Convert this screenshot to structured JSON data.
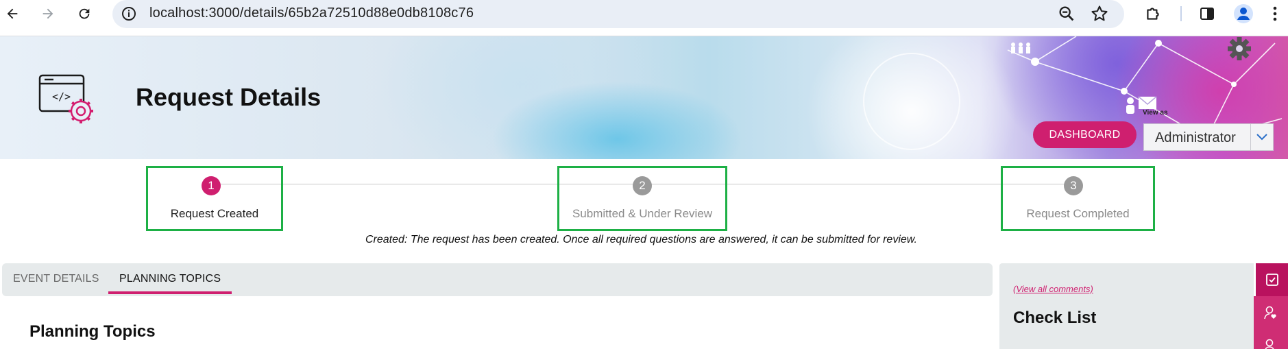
{
  "browser": {
    "url": "localhost:3000/details/65b2a72510d88e0db8108c76",
    "icons": [
      "back-arrow-icon",
      "forward-arrow-icon",
      "reload-icon",
      "site-info-icon",
      "zoom-icon",
      "star-icon",
      "extensions-icon",
      "side-panel-icon",
      "profile-icon",
      "more-menu-icon"
    ]
  },
  "header": {
    "title": "Request Details",
    "dashboard_label": "DASHBOARD",
    "view_as_label": "View as",
    "role_value": "Administrator"
  },
  "stepper": {
    "steps": [
      {
        "number": "1",
        "label": "Request Created",
        "state": "active"
      },
      {
        "number": "2",
        "label": "Submitted & Under Review",
        "state": "pending"
      },
      {
        "number": "3",
        "label": "Request Completed",
        "state": "pending"
      }
    ],
    "status_message": "Created: The request has been created. Once all required questions are answered, it can be submitted for review."
  },
  "tabs": [
    {
      "label": "EVENT DETAILS",
      "active": false
    },
    {
      "label": "PLANNING TOPICS",
      "active": true
    }
  ],
  "main": {
    "section_title": "Planning Topics"
  },
  "side_panel": {
    "view_all_comments": "(View all comments)",
    "title": "Check List"
  },
  "colors": {
    "accent": "#cf1f6f",
    "highlight_box": "#1db045",
    "step_active": "#cf1f6f",
    "step_pending": "#9a9a9a"
  }
}
